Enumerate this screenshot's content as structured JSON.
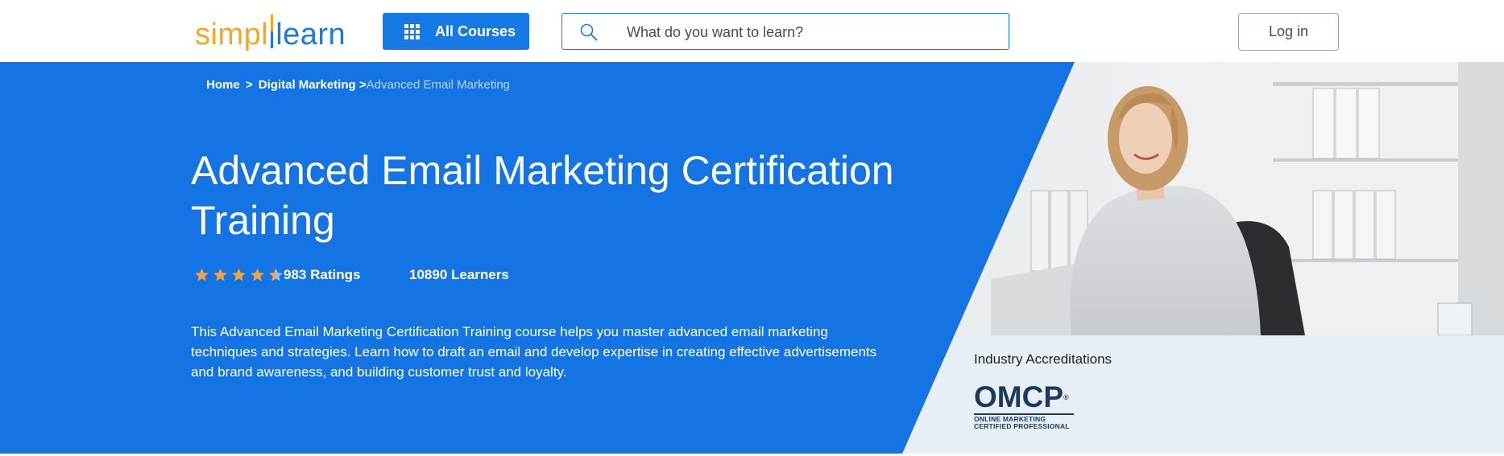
{
  "brand": {
    "logo_part1": "simpl",
    "logo_part2": "learn"
  },
  "header": {
    "all_courses_label": "All Courses",
    "search_placeholder": "What do you want to learn?",
    "login_label": "Log in"
  },
  "breadcrumb": {
    "home": "Home",
    "sep1": ">",
    "category": "Digital Marketing",
    "sep2": ">",
    "current": "Advanced Email Marketing"
  },
  "course": {
    "title": "Advanced Email Marketing Certification Training",
    "rating_value": 4.5,
    "ratings_label": "983 Ratings",
    "learners_label": "10890 Learners",
    "description": "This Advanced Email Marketing Certification Training course helps you master advanced email marketing techniques and strategies. Learn how to draft an email and develop expertise in creating effective advertisements and brand awareness, and building customer trust and loyalty."
  },
  "accreditations": {
    "title": "Industry Accreditations",
    "logo_text": "OMCP",
    "logo_line1": "ONLINE MARKETING",
    "logo_line2": "CERTIFIED PROFESSIONAL"
  },
  "colors": {
    "brand_blue": "#1679e6",
    "hero_blue": "#1474e4",
    "logo_orange": "#f5a623",
    "star_orange": "#f7a33b"
  },
  "icons": {
    "menu": "grid-icon",
    "search": "search-icon",
    "rating": "star-icon"
  }
}
